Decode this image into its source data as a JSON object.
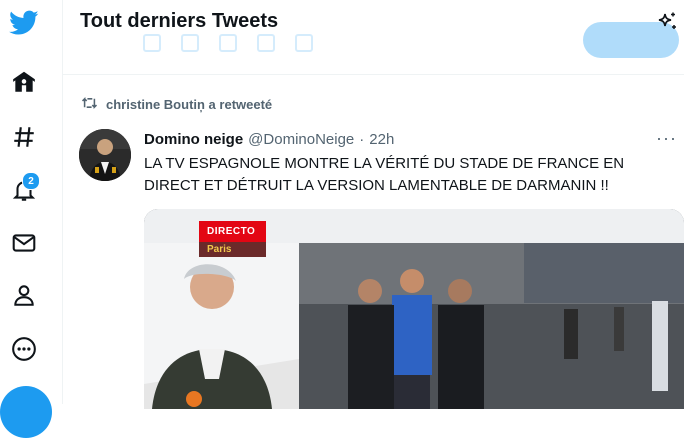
{
  "sidebar": {
    "logo": "twitter-bird-icon",
    "items": [
      {
        "name": "home",
        "icon": "home-icon"
      },
      {
        "name": "explore",
        "icon": "hashtag-icon"
      },
      {
        "name": "notifications",
        "icon": "bell-icon",
        "badge": "2"
      },
      {
        "name": "messages",
        "icon": "envelope-icon"
      },
      {
        "name": "profile",
        "icon": "person-icon"
      },
      {
        "name": "more",
        "icon": "more-circle-icon"
      }
    ]
  },
  "header": {
    "title": "Tout derniers Tweets",
    "sparkle_icon": "sparkle-icon"
  },
  "tweet": {
    "retweeted_by": "christine Boutin̦ a retweeté",
    "author_name": "Domino neige",
    "author_handle": "@DominoNeige",
    "separator": "·",
    "time": "22h",
    "more_label": "···",
    "text": "LA TV ESPAGNOLE MONTRE LA VÉRITÉ DU STADE DE FRANCE EN DIRECT ET DÉTRUIT LA VERSION LAMENTABLE DE DARMANIN !!",
    "media": {
      "overlay_label": "DIRECTO",
      "overlay_location": "Paris"
    }
  },
  "colors": {
    "brand": "#1d9bf0",
    "text": "#0f1419",
    "secondary": "#536471",
    "directo_red": "#e30613"
  }
}
